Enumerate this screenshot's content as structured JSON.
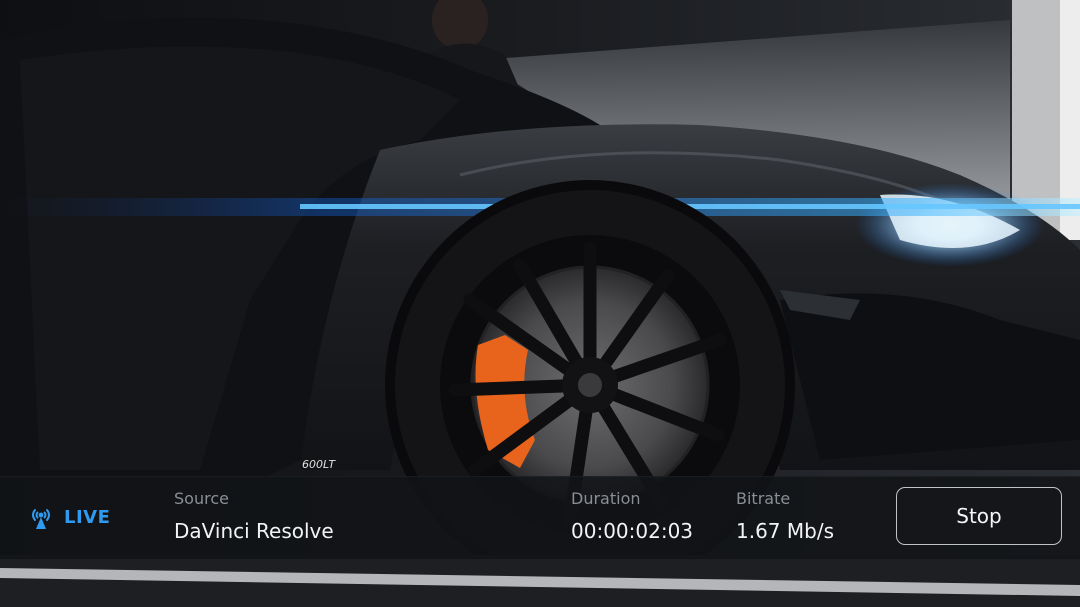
{
  "status": {
    "live_label": "LIVE",
    "live_icon": "broadcast-icon",
    "accent_color": "#2f9bf0",
    "source": {
      "label": "Source",
      "value": "DaVinci Resolve"
    },
    "duration": {
      "label": "Duration",
      "value": "00:00:02:03"
    },
    "bitrate": {
      "label": "Bitrate",
      "value": "1.67 Mb/s"
    },
    "stop_label": "Stop"
  },
  "preview": {
    "badge_text": "600LT"
  }
}
